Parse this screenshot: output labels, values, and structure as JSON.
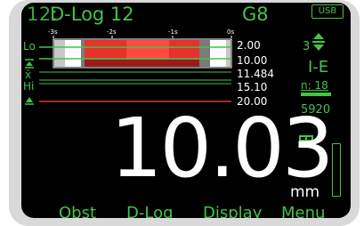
{
  "header": {
    "file_id": "12:",
    "file_name": "D-Log 12",
    "gauge_model": "G8",
    "usb_label": "USB"
  },
  "scan_chart": {
    "tick_labels": [
      "-3s",
      "-2s",
      "-1s",
      "0s"
    ],
    "lo_label": "Lo",
    "min_icon": "min-marker-icon",
    "avg_label": "x̄",
    "hi_label": "Hi",
    "max_icon": "max-marker-icon",
    "values": {
      "lo_limit": "2.00",
      "minimum": "10.00",
      "average": "11.484",
      "hi_limit": "15.10",
      "maximum": "20.00"
    },
    "colors": {
      "bar": "#e5322d",
      "bar_dark": "#9c1c1a",
      "trace": "#45c24a",
      "alarm_line": "#e5322d"
    }
  },
  "status_panel": {
    "count": "3",
    "updown_icon": "up-down-arrows-icon",
    "mode": "I-E",
    "n_label": "n: 18",
    "velocity": "5920",
    "datalog_icon": "datalog-grid-icon"
  },
  "reading": {
    "value": "10.03",
    "unit": "mm",
    "signal_level": 0.0
  },
  "softkeys": {
    "key1": "Obst",
    "key2": "D-Log",
    "key3": "Display",
    "key4": "Menu"
  }
}
